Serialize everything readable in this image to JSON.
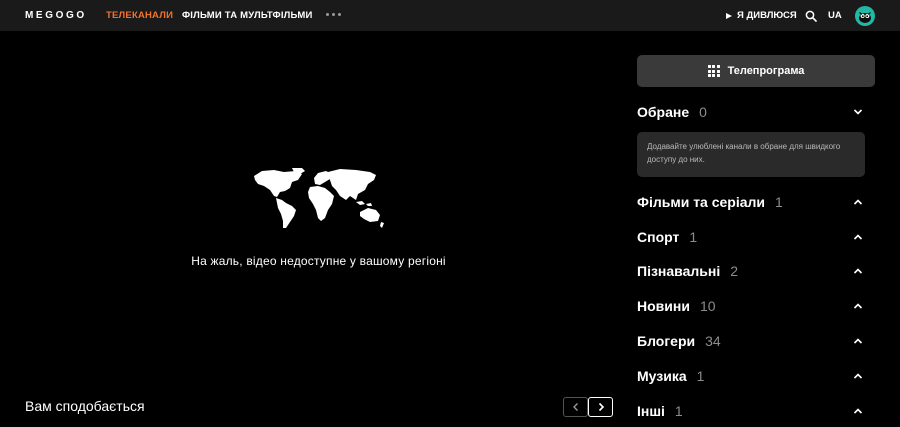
{
  "header": {
    "logo": "MEGOGO",
    "nav": [
      {
        "label": "ТЕЛЕКАНАЛИ",
        "active": true
      },
      {
        "label": "ФІЛЬМИ ТА МУЛЬТФІЛЬМИ",
        "active": false
      }
    ],
    "watching_label": "Я ДИВЛЮСЯ",
    "lang": "UA",
    "accent_color": "#f1722f"
  },
  "player": {
    "message": "На жаль, відео недоступне у вашому регіоні",
    "icon": "world-map-icon"
  },
  "recommend": {
    "title": "Вам сподобається"
  },
  "sidebar": {
    "tvguide_label": "Телепрограма",
    "favorites": {
      "name": "Обране",
      "count": "0",
      "hint": "Додавайте улюблені канали в обране для швидкого доступу до них."
    },
    "categories": [
      {
        "name": "Фільми та серіали",
        "count": "1"
      },
      {
        "name": "Спорт",
        "count": "1"
      },
      {
        "name": "Пізнавальні",
        "count": "2"
      },
      {
        "name": "Новини",
        "count": "10"
      },
      {
        "name": "Блогери",
        "count": "34"
      },
      {
        "name": "Музика",
        "count": "1"
      },
      {
        "name": "Інші",
        "count": "1"
      }
    ]
  }
}
